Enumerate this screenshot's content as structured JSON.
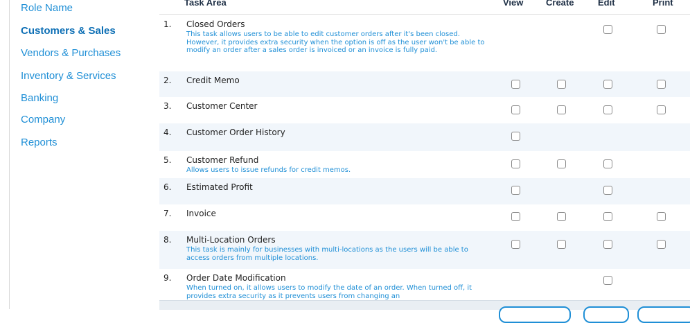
{
  "sidebar": {
    "items": [
      {
        "label": "Role Name",
        "active": false
      },
      {
        "label": "Customers & Sales",
        "active": true
      },
      {
        "label": "Vendors & Purchases",
        "active": false
      },
      {
        "label": "Inventory & Services",
        "active": false
      },
      {
        "label": "Banking",
        "active": false
      },
      {
        "label": "Company",
        "active": false
      },
      {
        "label": "Reports",
        "active": false
      }
    ]
  },
  "table": {
    "headers": {
      "task_area": "Task Area",
      "view": "View",
      "create": "Create",
      "edit": "Edit",
      "print": "Print"
    },
    "rows": [
      {
        "num": "1.",
        "title": "Closed Orders",
        "desc": "This task allows users to be able to edit customer orders after it's been closed. However, it provides extra security when the option is off as the user won't be able to modify an order after a sales order is invoiced or an invoice is fully paid.",
        "view": false,
        "create": false,
        "edit": true,
        "print": true
      },
      {
        "num": "2.",
        "title": "Credit Memo",
        "desc": "",
        "view": true,
        "create": true,
        "edit": true,
        "print": true
      },
      {
        "num": "3.",
        "title": "Customer Center",
        "desc": "",
        "view": true,
        "create": true,
        "edit": true,
        "print": true
      },
      {
        "num": "4.",
        "title": "Customer Order History",
        "desc": "",
        "view": true,
        "create": false,
        "edit": false,
        "print": false
      },
      {
        "num": "5.",
        "title": "Customer Refund",
        "desc": "Allows users to issue refunds for credit memos.",
        "view": true,
        "create": true,
        "edit": true,
        "print": false
      },
      {
        "num": "6.",
        "title": "Estimated Profit",
        "desc": "",
        "view": true,
        "create": false,
        "edit": true,
        "print": false
      },
      {
        "num": "7.",
        "title": "Invoice",
        "desc": "",
        "view": true,
        "create": true,
        "edit": true,
        "print": true
      },
      {
        "num": "8.",
        "title": "Multi-Location Orders",
        "desc": "This task is mainly for businesses with multi-locations as the users will be able to access orders from multiple locations.",
        "view": true,
        "create": true,
        "edit": true,
        "print": true
      },
      {
        "num": "9.",
        "title": "Order Date Modification",
        "desc": "When turned on, it allows users to modify the date of an order. When turned off, it provides extra security as it prevents users from changing an",
        "view": false,
        "create": false,
        "edit": true,
        "print": false
      }
    ]
  }
}
